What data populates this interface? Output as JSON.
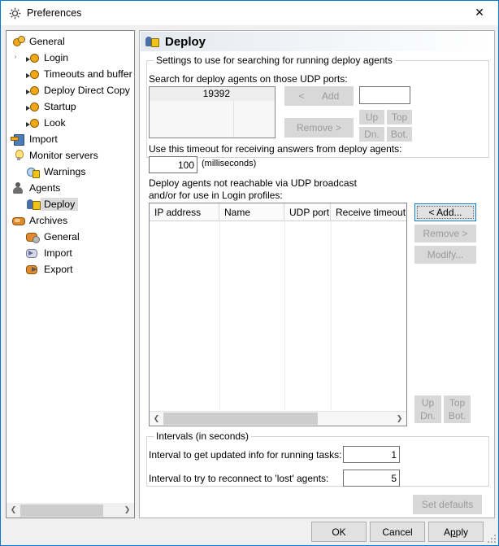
{
  "window": {
    "title": "Preferences",
    "icon": "gear-icon",
    "close_label": "✕",
    "accent_color": "#0078d7"
  },
  "sidebar": {
    "items": [
      {
        "label": "General",
        "icon": "gears-icon",
        "indent": 0,
        "expander": "",
        "selected": false
      },
      {
        "label": "Login",
        "icon": "gear-small-icon",
        "indent": 1,
        "expander": "›",
        "selected": false
      },
      {
        "label": "Timeouts and buffer",
        "icon": "gear-small-icon",
        "indent": 1,
        "expander": "",
        "selected": false
      },
      {
        "label": "Deploy Direct Copy",
        "icon": "gear-small-icon",
        "indent": 1,
        "expander": "",
        "selected": false
      },
      {
        "label": "Startup",
        "icon": "gear-small-icon",
        "indent": 1,
        "expander": "",
        "selected": false
      },
      {
        "label": "Look",
        "icon": "gear-small-icon",
        "indent": 1,
        "expander": "",
        "selected": false
      },
      {
        "label": "Import",
        "icon": "import-icon",
        "indent": 0,
        "expander": "",
        "selected": false
      },
      {
        "label": "Monitor servers",
        "icon": "lightbulb-icon",
        "indent": 0,
        "expander": "",
        "selected": false
      },
      {
        "label": "Warnings",
        "icon": "warning-icon",
        "indent": 1,
        "expander": "",
        "selected": false
      },
      {
        "label": "Agents",
        "icon": "person-icon",
        "indent": 0,
        "expander": "",
        "selected": false
      },
      {
        "label": "Deploy",
        "icon": "deploy-icon",
        "indent": 1,
        "expander": "",
        "selected": true
      },
      {
        "label": "Archives",
        "icon": "archive-icon",
        "indent": 0,
        "expander": "",
        "selected": false
      },
      {
        "label": "General",
        "icon": "archive-general-icon",
        "indent": 1,
        "expander": "",
        "selected": false
      },
      {
        "label": "Import",
        "icon": "archive-import-icon",
        "indent": 1,
        "expander": "",
        "selected": false
      },
      {
        "label": "Export",
        "icon": "archive-export-icon",
        "indent": 1,
        "expander": "",
        "selected": false
      }
    ],
    "scrollbar": {
      "left_arrow": "❮",
      "right_arrow": "❯"
    }
  },
  "panel": {
    "title": "Deploy",
    "icon": "deploy-icon",
    "search_group": {
      "title": "Settings to use for searching for running deploy agents",
      "ports_label": "Search for deploy agents on those UDP ports:",
      "ports": [
        "19392"
      ],
      "port_input_value": "",
      "buttons": {
        "add_arrow": "<",
        "add": "Add",
        "remove": "Remove >",
        "up": "Up",
        "top": "Top",
        "dn": "Dn.",
        "bot": "Bot."
      },
      "timeout_label": "Use this timeout for receiving answers from deploy agents:",
      "timeout_value": "100",
      "timeout_units": "(milliseconds)"
    },
    "agents_table": {
      "caption_line1": "Deploy agents not reachable via UDP broadcast",
      "caption_line2": "and/or for use in Login profiles:",
      "columns": [
        "IP address",
        "Name",
        "UDP port",
        "Receive timeout (in"
      ],
      "rows": [],
      "buttons": {
        "add": "<   Add...",
        "remove": "Remove >",
        "modify": "Modify...",
        "up": "Up",
        "top": "Top",
        "dn": "Dn.",
        "bot": "Bot."
      },
      "scrollbar": {
        "left_arrow": "❮",
        "right_arrow": "❯"
      }
    },
    "intervals_group": {
      "title": "Intervals (in seconds)",
      "rows": [
        {
          "label": "Interval to get updated info for running tasks:",
          "value": "1"
        },
        {
          "label": "Interval to try to reconnect to 'lost' agents:",
          "value": "5"
        }
      ]
    },
    "set_defaults_label": "Set defaults"
  },
  "footer": {
    "ok": "OK",
    "cancel": "Cancel",
    "apply_pre": "A",
    "apply_underlined": "p",
    "apply_post": "ply"
  }
}
